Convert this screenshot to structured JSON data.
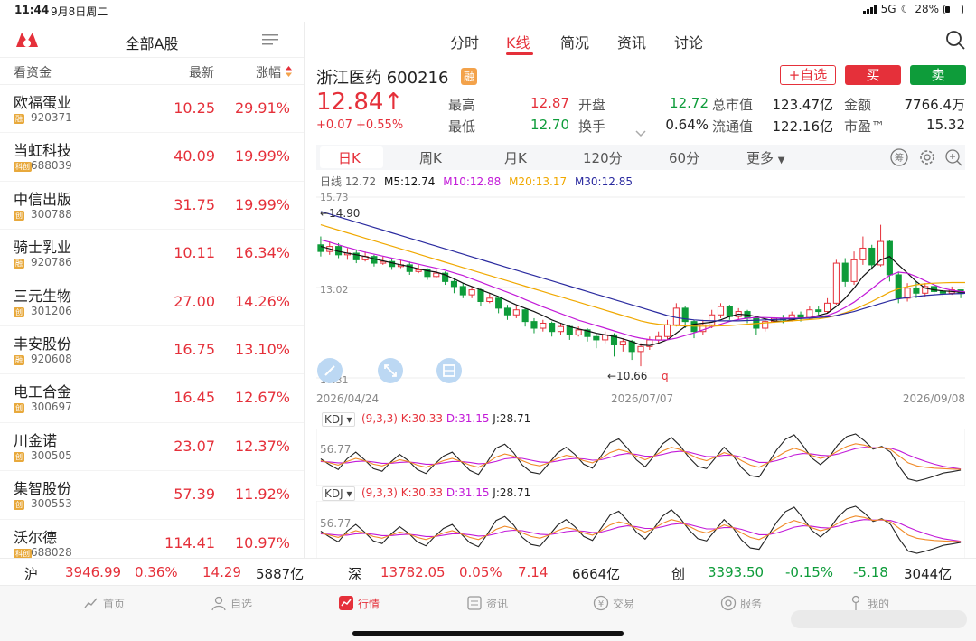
{
  "status": {
    "time": "11:44",
    "date": "9月8日周二",
    "network": "5G",
    "battery": "28%"
  },
  "left": {
    "title": "全部A股",
    "headers": {
      "name": "看资金",
      "price": "最新",
      "change": "涨幅"
    },
    "stocks": [
      {
        "name": "欧福蛋业",
        "badge": "融",
        "code": "920371",
        "price": "10.25",
        "change": "29.91%"
      },
      {
        "name": "当虹科技",
        "badge": "科创",
        "code": "688039",
        "price": "40.09",
        "change": "19.99%"
      },
      {
        "name": "中信出版",
        "badge": "创",
        "code": "300788",
        "price": "31.75",
        "change": "19.99%"
      },
      {
        "name": "骑士乳业",
        "badge": "融",
        "code": "920786",
        "price": "10.11",
        "change": "16.34%"
      },
      {
        "name": "三元生物",
        "badge": "创",
        "code": "301206",
        "price": "27.00",
        "change": "14.26%"
      },
      {
        "name": "丰安股份",
        "badge": "融",
        "code": "920608",
        "price": "16.75",
        "change": "13.10%"
      },
      {
        "name": "电工合金",
        "badge": "创",
        "code": "300697",
        "price": "16.45",
        "change": "12.67%"
      },
      {
        "name": "川金诺",
        "badge": "创",
        "code": "300505",
        "price": "23.07",
        "change": "12.37%"
      },
      {
        "name": "集智股份",
        "badge": "创",
        "code": "300553",
        "price": "57.39",
        "change": "11.92%"
      },
      {
        "name": "沃尔德",
        "badge": "科创",
        "code": "688028",
        "price": "114.41",
        "change": "10.97%"
      }
    ]
  },
  "tabs": [
    "分时",
    "K线",
    "简况",
    "资讯",
    "讨论"
  ],
  "stock": {
    "name": "浙江医药",
    "code": "600216",
    "rong": "融",
    "price": "12.84",
    "arrow": "↑",
    "change": "+0.07",
    "change_pct": "+0.55%",
    "watch": "+自选",
    "buy": "买",
    "sell": "卖",
    "quotes": [
      {
        "label": "最高",
        "value": "12.87",
        "color": "red"
      },
      {
        "label": "开盘",
        "value": "12.72",
        "color": "green"
      },
      {
        "label": "总市值",
        "value": "123.47亿",
        "color": "dark"
      },
      {
        "label": "金额",
        "value": "7766.4万",
        "color": "dark"
      },
      {
        "label": "最低",
        "value": "12.70",
        "color": "green"
      },
      {
        "label": "换手",
        "value": "0.64%",
        "color": "dark"
      },
      {
        "label": "流通值",
        "value": "122.16亿",
        "color": "dark"
      },
      {
        "label": "市盈™",
        "value": "15.32",
        "color": "dark"
      }
    ]
  },
  "periods": [
    "日K",
    "周K",
    "月K",
    "120分",
    "60分",
    "更多"
  ],
  "ma": {
    "day": "日线 12.72",
    "m5": "M5:12.74",
    "m10": "M10:12.88",
    "m20": "M20:13.17",
    "m30": "M30:12.85",
    "colors": {
      "m5": "#111111",
      "m10": "#c21ad8",
      "m20": "#f0a800",
      "m30": "#2a2a9f"
    }
  },
  "axis": {
    "top": "15.73",
    "mid": "13.02",
    "bottom": "10.31",
    "high_mark": "←14.90",
    "low_mark": "←10.66",
    "q_mark": "q",
    "date_start": "2026/04/24",
    "date_mid": "2026/07/07",
    "date_end": "2026/09/08"
  },
  "kdj": {
    "name": "KDJ",
    "params": "(9,3,3)",
    "k": "K:30.33",
    "d": "D:31.15",
    "j": "J:28.71",
    "ref": "56.77"
  },
  "indices": [
    {
      "name": "沪",
      "value": "3946.99",
      "pct": "0.36%",
      "chg": "14.29",
      "vol": "5887亿",
      "color": "red"
    },
    {
      "name": "深",
      "value": "13782.05",
      "pct": "0.05%",
      "chg": "7.14",
      "vol": "6664亿",
      "color": "red"
    },
    {
      "name": "创",
      "value": "3393.50",
      "pct": "-0.15%",
      "chg": "-5.18",
      "vol": "3044亿",
      "color": "green"
    }
  ],
  "nav": [
    "首页",
    "自选",
    "行情",
    "资讯",
    "交易",
    "服务",
    "我的"
  ],
  "chart_data": {
    "type": "line",
    "y_range": [
      10.31,
      15.73
    ],
    "candles": [
      {
        "o": 14.3,
        "c": 14.1,
        "h": 14.55,
        "l": 13.95
      },
      {
        "o": 14.1,
        "c": 14.25,
        "h": 14.4,
        "l": 14.0
      },
      {
        "o": 14.25,
        "c": 14.0,
        "h": 14.35,
        "l": 13.9
      },
      {
        "o": 14.0,
        "c": 14.05,
        "h": 14.2,
        "l": 13.85
      },
      {
        "o": 14.05,
        "c": 13.85,
        "h": 14.15,
        "l": 13.75
      },
      {
        "o": 13.85,
        "c": 13.95,
        "h": 14.1,
        "l": 13.8
      },
      {
        "o": 13.95,
        "c": 13.75,
        "h": 14.0,
        "l": 13.65
      },
      {
        "o": 13.75,
        "c": 13.8,
        "h": 13.95,
        "l": 13.7
      },
      {
        "o": 13.8,
        "c": 13.65,
        "h": 13.9,
        "l": 13.55
      },
      {
        "o": 13.65,
        "c": 13.7,
        "h": 13.85,
        "l": 13.6
      },
      {
        "o": 13.7,
        "c": 13.5,
        "h": 13.8,
        "l": 13.4
      },
      {
        "o": 13.5,
        "c": 13.55,
        "h": 13.7,
        "l": 13.45
      },
      {
        "o": 13.55,
        "c": 13.35,
        "h": 13.6,
        "l": 13.25
      },
      {
        "o": 13.35,
        "c": 13.45,
        "h": 13.55,
        "l": 13.3
      },
      {
        "o": 13.45,
        "c": 13.2,
        "h": 13.5,
        "l": 13.1
      },
      {
        "o": 13.2,
        "c": 13.05,
        "h": 13.3,
        "l": 12.85
      },
      {
        "o": 13.05,
        "c": 12.8,
        "h": 13.15,
        "l": 12.7
      },
      {
        "o": 12.8,
        "c": 12.95,
        "h": 13.05,
        "l": 12.7
      },
      {
        "o": 12.95,
        "c": 12.6,
        "h": 13.0,
        "l": 12.45
      },
      {
        "o": 12.6,
        "c": 12.7,
        "h": 12.85,
        "l": 12.55
      },
      {
        "o": 12.7,
        "c": 12.4,
        "h": 12.75,
        "l": 12.25
      },
      {
        "o": 12.4,
        "c": 12.2,
        "h": 12.5,
        "l": 12.05
      },
      {
        "o": 12.2,
        "c": 12.35,
        "h": 12.45,
        "l": 12.1
      },
      {
        "o": 12.35,
        "c": 12.0,
        "h": 12.4,
        "l": 11.85
      },
      {
        "o": 12.0,
        "c": 11.8,
        "h": 12.1,
        "l": 11.65
      },
      {
        "o": 11.8,
        "c": 11.95,
        "h": 12.05,
        "l": 11.7
      },
      {
        "o": 11.95,
        "c": 11.7,
        "h": 12.0,
        "l": 11.55
      },
      {
        "o": 11.7,
        "c": 11.85,
        "h": 11.95,
        "l": 11.6
      },
      {
        "o": 11.85,
        "c": 11.6,
        "h": 11.9,
        "l": 11.45
      },
      {
        "o": 11.6,
        "c": 11.75,
        "h": 11.85,
        "l": 11.55
      },
      {
        "o": 11.75,
        "c": 11.55,
        "h": 11.8,
        "l": 11.4
      },
      {
        "o": 11.55,
        "c": 11.45,
        "h": 11.65,
        "l": 11.2
      },
      {
        "o": 11.45,
        "c": 11.6,
        "h": 11.7,
        "l": 11.35
      },
      {
        "o": 11.6,
        "c": 11.3,
        "h": 11.65,
        "l": 10.95
      },
      {
        "o": 11.3,
        "c": 11.4,
        "h": 11.5,
        "l": 11.1
      },
      {
        "o": 11.4,
        "c": 11.1,
        "h": 11.45,
        "l": 10.85
      },
      {
        "o": 11.1,
        "c": 11.25,
        "h": 11.35,
        "l": 10.66
      },
      {
        "o": 11.25,
        "c": 11.45,
        "h": 11.55,
        "l": 11.15
      },
      {
        "o": 11.45,
        "c": 11.55,
        "h": 11.7,
        "l": 11.35
      },
      {
        "o": 11.55,
        "c": 11.9,
        "h": 12.05,
        "l": 11.45
      },
      {
        "o": 11.9,
        "c": 12.4,
        "h": 12.55,
        "l": 11.85
      },
      {
        "o": 12.4,
        "c": 12.0,
        "h": 12.45,
        "l": 11.8
      },
      {
        "o": 12.0,
        "c": 11.7,
        "h": 12.05,
        "l": 11.5
      },
      {
        "o": 11.7,
        "c": 11.9,
        "h": 12.05,
        "l": 11.6
      },
      {
        "o": 11.9,
        "c": 12.2,
        "h": 12.35,
        "l": 11.8
      },
      {
        "o": 12.2,
        "c": 12.45,
        "h": 12.55,
        "l": 12.1
      },
      {
        "o": 12.45,
        "c": 12.15,
        "h": 12.5,
        "l": 12.05
      },
      {
        "o": 12.15,
        "c": 12.3,
        "h": 12.4,
        "l": 12.05
      },
      {
        "o": 12.3,
        "c": 12.1,
        "h": 12.35,
        "l": 11.95
      },
      {
        "o": 12.1,
        "c": 11.8,
        "h": 12.15,
        "l": 11.6
      },
      {
        "o": 11.8,
        "c": 12.0,
        "h": 12.1,
        "l": 11.7
      },
      {
        "o": 12.0,
        "c": 12.1,
        "h": 12.2,
        "l": 11.9
      },
      {
        "o": 12.1,
        "c": 12.05,
        "h": 12.2,
        "l": 11.95
      },
      {
        "o": 12.05,
        "c": 12.2,
        "h": 12.3,
        "l": 12.0
      },
      {
        "o": 12.2,
        "c": 12.1,
        "h": 12.3,
        "l": 12.0
      },
      {
        "o": 12.1,
        "c": 12.35,
        "h": 12.45,
        "l": 12.05
      },
      {
        "o": 12.35,
        "c": 12.3,
        "h": 12.45,
        "l": 12.2
      },
      {
        "o": 12.3,
        "c": 12.55,
        "h": 12.7,
        "l": 12.25
      },
      {
        "o": 12.55,
        "c": 13.75,
        "h": 13.85,
        "l": 12.5
      },
      {
        "o": 13.75,
        "c": 13.2,
        "h": 13.9,
        "l": 13.05
      },
      {
        "o": 13.2,
        "c": 13.85,
        "h": 14.1,
        "l": 13.1
      },
      {
        "o": 13.85,
        "c": 14.2,
        "h": 14.55,
        "l": 13.7
      },
      {
        "o": 14.2,
        "c": 13.7,
        "h": 14.3,
        "l": 13.55
      },
      {
        "o": 13.7,
        "c": 14.4,
        "h": 14.9,
        "l": 13.65
      },
      {
        "o": 14.4,
        "c": 13.4,
        "h": 14.45,
        "l": 13.2
      },
      {
        "o": 13.4,
        "c": 12.7,
        "h": 13.5,
        "l": 12.55
      },
      {
        "o": 12.7,
        "c": 13.0,
        "h": 13.15,
        "l": 12.6
      },
      {
        "o": 13.0,
        "c": 12.85,
        "h": 13.2,
        "l": 12.7
      },
      {
        "o": 12.85,
        "c": 13.05,
        "h": 13.15,
        "l": 12.75
      },
      {
        "o": 13.05,
        "c": 12.9,
        "h": 13.1,
        "l": 12.8
      },
      {
        "o": 12.9,
        "c": 12.85,
        "h": 13.0,
        "l": 12.75
      },
      {
        "o": 12.85,
        "c": 12.95,
        "h": 13.05,
        "l": 12.8
      },
      {
        "o": 12.95,
        "c": 12.84,
        "h": 12.95,
        "l": 12.7
      }
    ],
    "ma5": [
      14.25,
      14.18,
      14.1,
      14.05,
      14.0,
      13.95,
      13.88,
      13.82,
      13.76,
      13.7,
      13.65,
      13.58,
      13.52,
      13.48,
      13.4,
      13.28,
      13.15,
      13.05,
      12.95,
      12.85,
      12.75,
      12.62,
      12.5,
      12.4,
      12.3,
      12.18,
      12.05,
      11.95,
      11.85,
      11.78,
      11.72,
      11.65,
      11.6,
      11.55,
      11.48,
      11.4,
      11.3,
      11.28,
      11.35,
      11.45,
      11.65,
      11.85,
      11.92,
      11.95,
      11.98,
      12.05,
      12.15,
      12.22,
      12.2,
      12.15,
      12.08,
      12.02,
      12.0,
      12.05,
      12.1,
      12.12,
      12.18,
      12.25,
      12.45,
      12.7,
      13.0,
      13.35,
      13.6,
      13.85,
      13.95,
      13.7,
      13.45,
      13.2,
      13.0,
      12.95,
      12.92,
      12.9,
      12.88,
      12.86
    ],
    "ma10": [
      14.45,
      14.38,
      14.3,
      14.22,
      14.15,
      14.08,
      14.02,
      13.96,
      13.9,
      13.84,
      13.78,
      13.72,
      13.66,
      13.6,
      13.54,
      13.46,
      13.38,
      13.28,
      13.18,
      13.08,
      12.98,
      12.88,
      12.78,
      12.66,
      12.55,
      12.44,
      12.34,
      12.24,
      12.14,
      12.04,
      11.96,
      11.88,
      11.8,
      11.72,
      11.64,
      11.56,
      11.5,
      11.46,
      11.44,
      11.45,
      11.5,
      11.58,
      11.66,
      11.75,
      11.84,
      11.92,
      12.0,
      12.06,
      12.1,
      12.12,
      12.12,
      12.11,
      12.1,
      12.1,
      12.1,
      12.12,
      12.14,
      12.18,
      12.28,
      12.42,
      12.58,
      12.78,
      12.98,
      13.2,
      13.38,
      13.48,
      13.45,
      13.35,
      13.22,
      13.1,
      13.0,
      12.94,
      12.9,
      12.88
    ],
    "ma20": [
      14.9,
      14.82,
      14.74,
      14.66,
      14.58,
      14.5,
      14.42,
      14.34,
      14.26,
      14.18,
      14.1,
      14.02,
      13.94,
      13.86,
      13.78,
      13.7,
      13.62,
      13.54,
      13.46,
      13.38,
      13.3,
      13.22,
      13.14,
      13.06,
      12.98,
      12.9,
      12.82,
      12.74,
      12.66,
      12.58,
      12.5,
      12.42,
      12.34,
      12.26,
      12.18,
      12.1,
      12.02,
      11.96,
      11.92,
      11.9,
      11.88,
      11.87,
      11.86,
      11.86,
      11.86,
      11.87,
      11.88,
      11.9,
      11.92,
      11.94,
      11.96,
      11.98,
      12.0,
      12.02,
      12.04,
      12.06,
      12.08,
      12.12,
      12.18,
      12.26,
      12.36,
      12.48,
      12.6,
      12.74,
      12.88,
      12.98,
      13.05,
      13.1,
      13.13,
      13.15,
      13.16,
      13.17,
      13.17,
      13.17
    ],
    "ma30": [
      15.3,
      15.22,
      15.14,
      15.06,
      14.98,
      14.9,
      14.82,
      14.74,
      14.66,
      14.58,
      14.5,
      14.42,
      14.34,
      14.26,
      14.18,
      14.1,
      14.02,
      13.94,
      13.86,
      13.78,
      13.7,
      13.62,
      13.54,
      13.46,
      13.38,
      13.3,
      13.22,
      13.14,
      13.06,
      12.98,
      12.9,
      12.82,
      12.74,
      12.66,
      12.58,
      12.5,
      12.42,
      12.34,
      12.26,
      12.18,
      12.12,
      12.08,
      12.05,
      12.03,
      12.02,
      12.02,
      12.02,
      12.02,
      12.03,
      12.04,
      12.05,
      12.06,
      12.07,
      12.08,
      12.09,
      12.1,
      12.12,
      12.14,
      12.18,
      12.24,
      12.3,
      12.38,
      12.46,
      12.54,
      12.62,
      12.68,
      12.72,
      12.75,
      12.78,
      12.8,
      12.82,
      12.83,
      12.84,
      12.85
    ],
    "kdj_k": [
      50,
      45,
      40,
      48,
      55,
      50,
      42,
      38,
      45,
      52,
      48,
      40,
      35,
      42,
      50,
      55,
      48,
      40,
      35,
      45,
      58,
      65,
      60,
      50,
      42,
      38,
      45,
      55,
      62,
      58,
      50,
      45,
      55,
      68,
      75,
      70,
      60,
      52,
      60,
      72,
      80,
      75,
      65,
      55,
      50,
      58,
      68,
      62,
      50,
      40,
      35,
      45,
      58,
      70,
      78,
      72,
      62,
      55,
      60,
      72,
      82,
      88,
      85,
      78,
      80,
      75,
      60,
      45,
      38,
      35,
      33,
      32,
      31,
      30.33
    ],
    "kdj_d": [
      48,
      47,
      45,
      45,
      48,
      49,
      47,
      44,
      44,
      46,
      47,
      45,
      42,
      42,
      45,
      48,
      48,
      46,
      43,
      44,
      48,
      54,
      56,
      55,
      51,
      47,
      46,
      49,
      53,
      55,
      54,
      51,
      52,
      57,
      63,
      66,
      64,
      60,
      60,
      64,
      69,
      71,
      69,
      64,
      59,
      59,
      62,
      62,
      58,
      52,
      46,
      46,
      50,
      56,
      63,
      66,
      65,
      62,
      61,
      65,
      71,
      77,
      80,
      79,
      79,
      78,
      72,
      63,
      55,
      48,
      42,
      37,
      34,
      31.15
    ],
    "kdj_j": [
      54,
      41,
      30,
      54,
      69,
      52,
      32,
      26,
      47,
      64,
      50,
      30,
      21,
      42,
      60,
      69,
      48,
      28,
      19,
      47,
      78,
      87,
      68,
      40,
      24,
      20,
      43,
      67,
      80,
      64,
      42,
      33,
      61,
      90,
      99,
      78,
      52,
      36,
      60,
      88,
      102,
      83,
      57,
      37,
      32,
      56,
      80,
      62,
      34,
      16,
      13,
      43,
      74,
      98,
      108,
      84,
      56,
      41,
      58,
      86,
      104,
      110,
      95,
      76,
      82,
      69,
      36,
      9,
      4,
      9,
      15,
      22,
      25,
      28.71
    ]
  }
}
